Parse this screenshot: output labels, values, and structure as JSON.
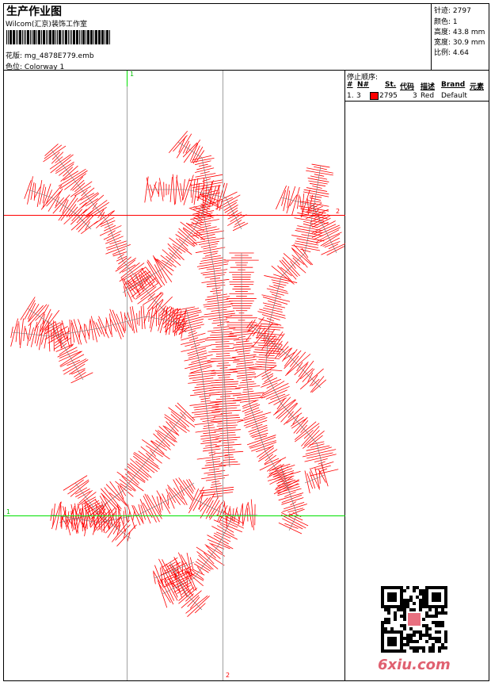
{
  "header": {
    "title": "生产作业图",
    "company": "Wilcom(汇京)装饰工作室",
    "design_label": "花版:",
    "design_file": "mg_4878E779.emb",
    "colorway_label": "色位:",
    "colorway": "Colorway 1"
  },
  "stats": [
    {
      "label": "针迹:",
      "value": "2797"
    },
    {
      "label": "颜色:",
      "value": "1"
    },
    {
      "label": "高度:",
      "value": "43.8 mm"
    },
    {
      "label": "宽度:",
      "value": "30.9 mm"
    },
    {
      "label": "比例:",
      "value": "4.64"
    }
  ],
  "stop_sequence": {
    "title": "停止顺序:",
    "columns": [
      "#",
      "N#",
      "St.",
      "代码",
      "描述",
      "Brand",
      "元素"
    ],
    "rows": [
      {
        "index": "1.",
        "n": "3",
        "color": "#ff0000",
        "stitches": "2795",
        "code": "3",
        "desc": "Red",
        "brand": "Default",
        "element": ""
      }
    ]
  },
  "guides": {
    "top": "1",
    "right": "2",
    "left": "1",
    "bottom": "2"
  },
  "colors": {
    "thread": "#ff0000",
    "guide_green": "#00e000",
    "guide_red": "#ff0000"
  },
  "watermark": "6xiu.com"
}
